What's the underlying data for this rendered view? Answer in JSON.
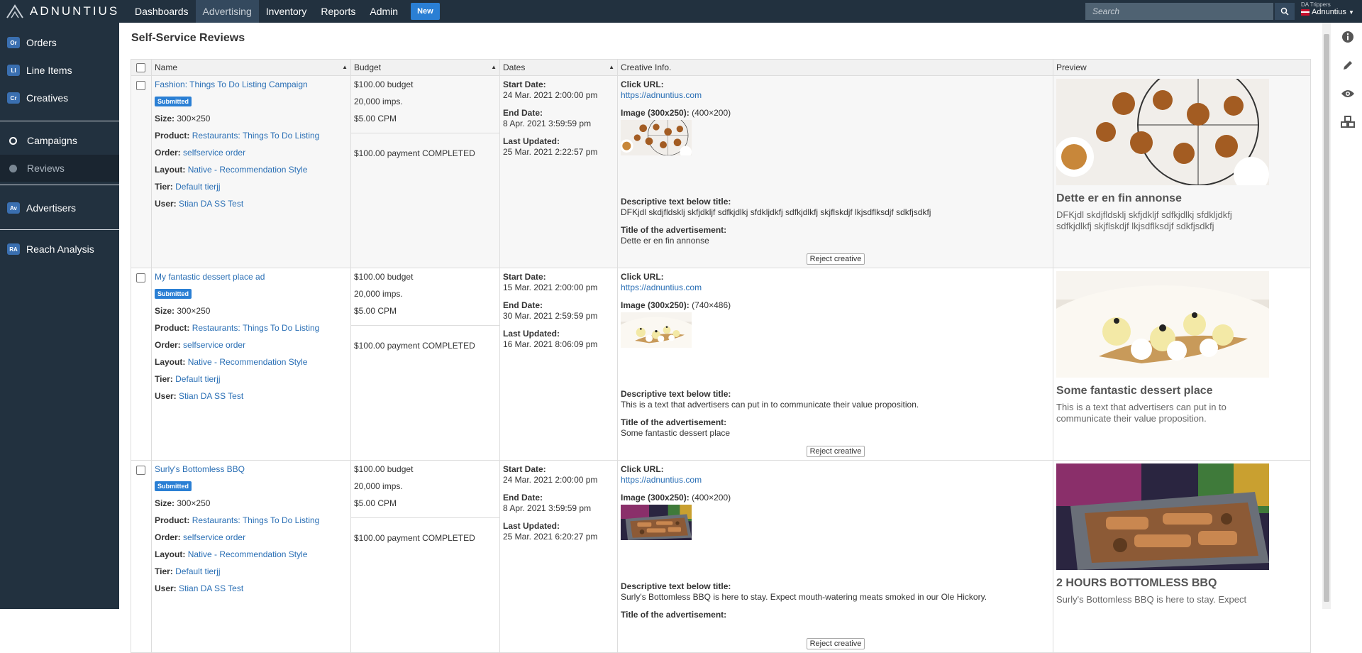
{
  "app": {
    "logo_text": "ADNUNTIUS"
  },
  "nav": {
    "items": [
      "Dashboards",
      "Advertising",
      "Inventory",
      "Reports",
      "Admin"
    ],
    "new_label": "New"
  },
  "search": {
    "placeholder": "Search"
  },
  "user": {
    "network": "DA Trippers",
    "name": "Adnuntius"
  },
  "sidebar": {
    "items": [
      {
        "badge": "Or",
        "label": "Orders"
      },
      {
        "badge": "LI",
        "label": "Line Items"
      },
      {
        "badge": "Cr",
        "label": "Creatives"
      },
      {
        "label": "Campaigns"
      },
      {
        "label": "Reviews"
      },
      {
        "badge": "Av",
        "label": "Advertisers"
      },
      {
        "badge": "RA",
        "label": "Reach Analysis"
      }
    ]
  },
  "page": {
    "title": "Self-Service Reviews"
  },
  "table": {
    "headers": [
      "Name",
      "Budget",
      "Dates",
      "Creative Info.",
      "Preview"
    ],
    "labels": {
      "size": "Size:",
      "product": "Product:",
      "order": "Order:",
      "layout": "Layout:",
      "tier": "Tier:",
      "user": "User:",
      "start": "Start Date:",
      "end": "End Date:",
      "updated": "Last Updated:",
      "click_url": "Click URL:",
      "image": "Image (300x250):",
      "desc": "Descriptive text below title:",
      "title": "Title of the advertisement:",
      "reject": "Reject creative"
    },
    "rows": [
      {
        "name": "Fashion: Things To Do Listing Campaign",
        "status": "Submitted",
        "size": "300×250",
        "product": "Restaurants: Things To Do Listing",
        "order": "selfservice order",
        "layout": "Native - Recommendation Style",
        "tier": "Default tierjj",
        "user": "Stian DA SS Test",
        "budget": "$100.00 budget",
        "imps": "20,000 imps.",
        "cpm": "$5.00 CPM",
        "payment": "$100.00 payment COMPLETED",
        "start": "24 Mar. 2021 2:00:00 pm",
        "end": "8 Apr. 2021 3:59:59 pm",
        "updated": "25 Mar. 2021 2:22:57 pm",
        "click_url": "https://adnuntius.com",
        "image_dims": "(400×200)",
        "desc": "DFKjdl skdjfldsklj skfjdkljf sdfkjdlkj sfdkljdkfj sdfkjdlkfj skjflskdjf lkjsdflksdjf sdkfjsdkfj",
        "ad_title": "Dette er en fin annonse",
        "preview_title": "Dette er en fin annonse",
        "preview_text": "DFKjdl skdjfldsklj skfjdkljf sdfkjdlkj sfdkljdkfj sdfkjdlkfj skjflskdjf lkjsdflksdjf sdkfjsdkfj",
        "image_kind": "muffins"
      },
      {
        "name": "My fantastic dessert place ad",
        "status": "Submitted",
        "size": "300×250",
        "product": "Restaurants: Things To Do Listing",
        "order": "selfservice order",
        "layout": "Native - Recommendation Style",
        "tier": "Default tierjj",
        "user": "Stian DA SS Test",
        "budget": "$100.00 budget",
        "imps": "20,000 imps.",
        "cpm": "$5.00 CPM",
        "payment": "$100.00 payment COMPLETED",
        "start": "15 Mar. 2021 2:00:00 pm",
        "end": "30 Mar. 2021 2:59:59 pm",
        "updated": "16 Mar. 2021 8:06:09 pm",
        "click_url": "https://adnuntius.com",
        "image_dims": "(740×486)",
        "desc": "This is a text that advertisers can put in to communicate their value proposition.",
        "ad_title": "Some fantastic dessert place",
        "preview_title": "Some fantastic dessert place",
        "preview_text": "This is a text that advertisers can put in to communicate their value proposition.",
        "image_kind": "dessert"
      },
      {
        "name": "Surly's Bottomless BBQ",
        "status": "Submitted",
        "size": "300×250",
        "product": "Restaurants: Things To Do Listing",
        "order": "selfservice order",
        "layout": "Native - Recommendation Style",
        "tier": "Default tierjj",
        "user": "Stian DA SS Test",
        "budget": "$100.00 budget",
        "imps": "20,000 imps.",
        "cpm": "$5.00 CPM",
        "payment": "$100.00 payment COMPLETED",
        "start": "24 Mar. 2021 2:00:00 pm",
        "end": "8 Apr. 2021 3:59:59 pm",
        "updated": "25 Mar. 2021 6:20:27 pm",
        "click_url": "https://adnuntius.com",
        "image_dims": "(400×200)",
        "desc": "Surly's Bottomless BBQ is here to stay. Expect mouth-watering meats smoked in our Ole Hickory.",
        "ad_title": "",
        "preview_title": "2 HOURS BOTTOMLESS BBQ",
        "preview_text": "Surly's Bottomless BBQ is here to stay. Expect",
        "image_kind": "bbq"
      }
    ]
  },
  "right_icons": [
    "info-icon",
    "pencil-icon",
    "eye-icon",
    "cubes-icon"
  ],
  "colors": {
    "topbar": "#22313f",
    "link": "#2a6fb5",
    "accent": "#2a7fd4"
  }
}
